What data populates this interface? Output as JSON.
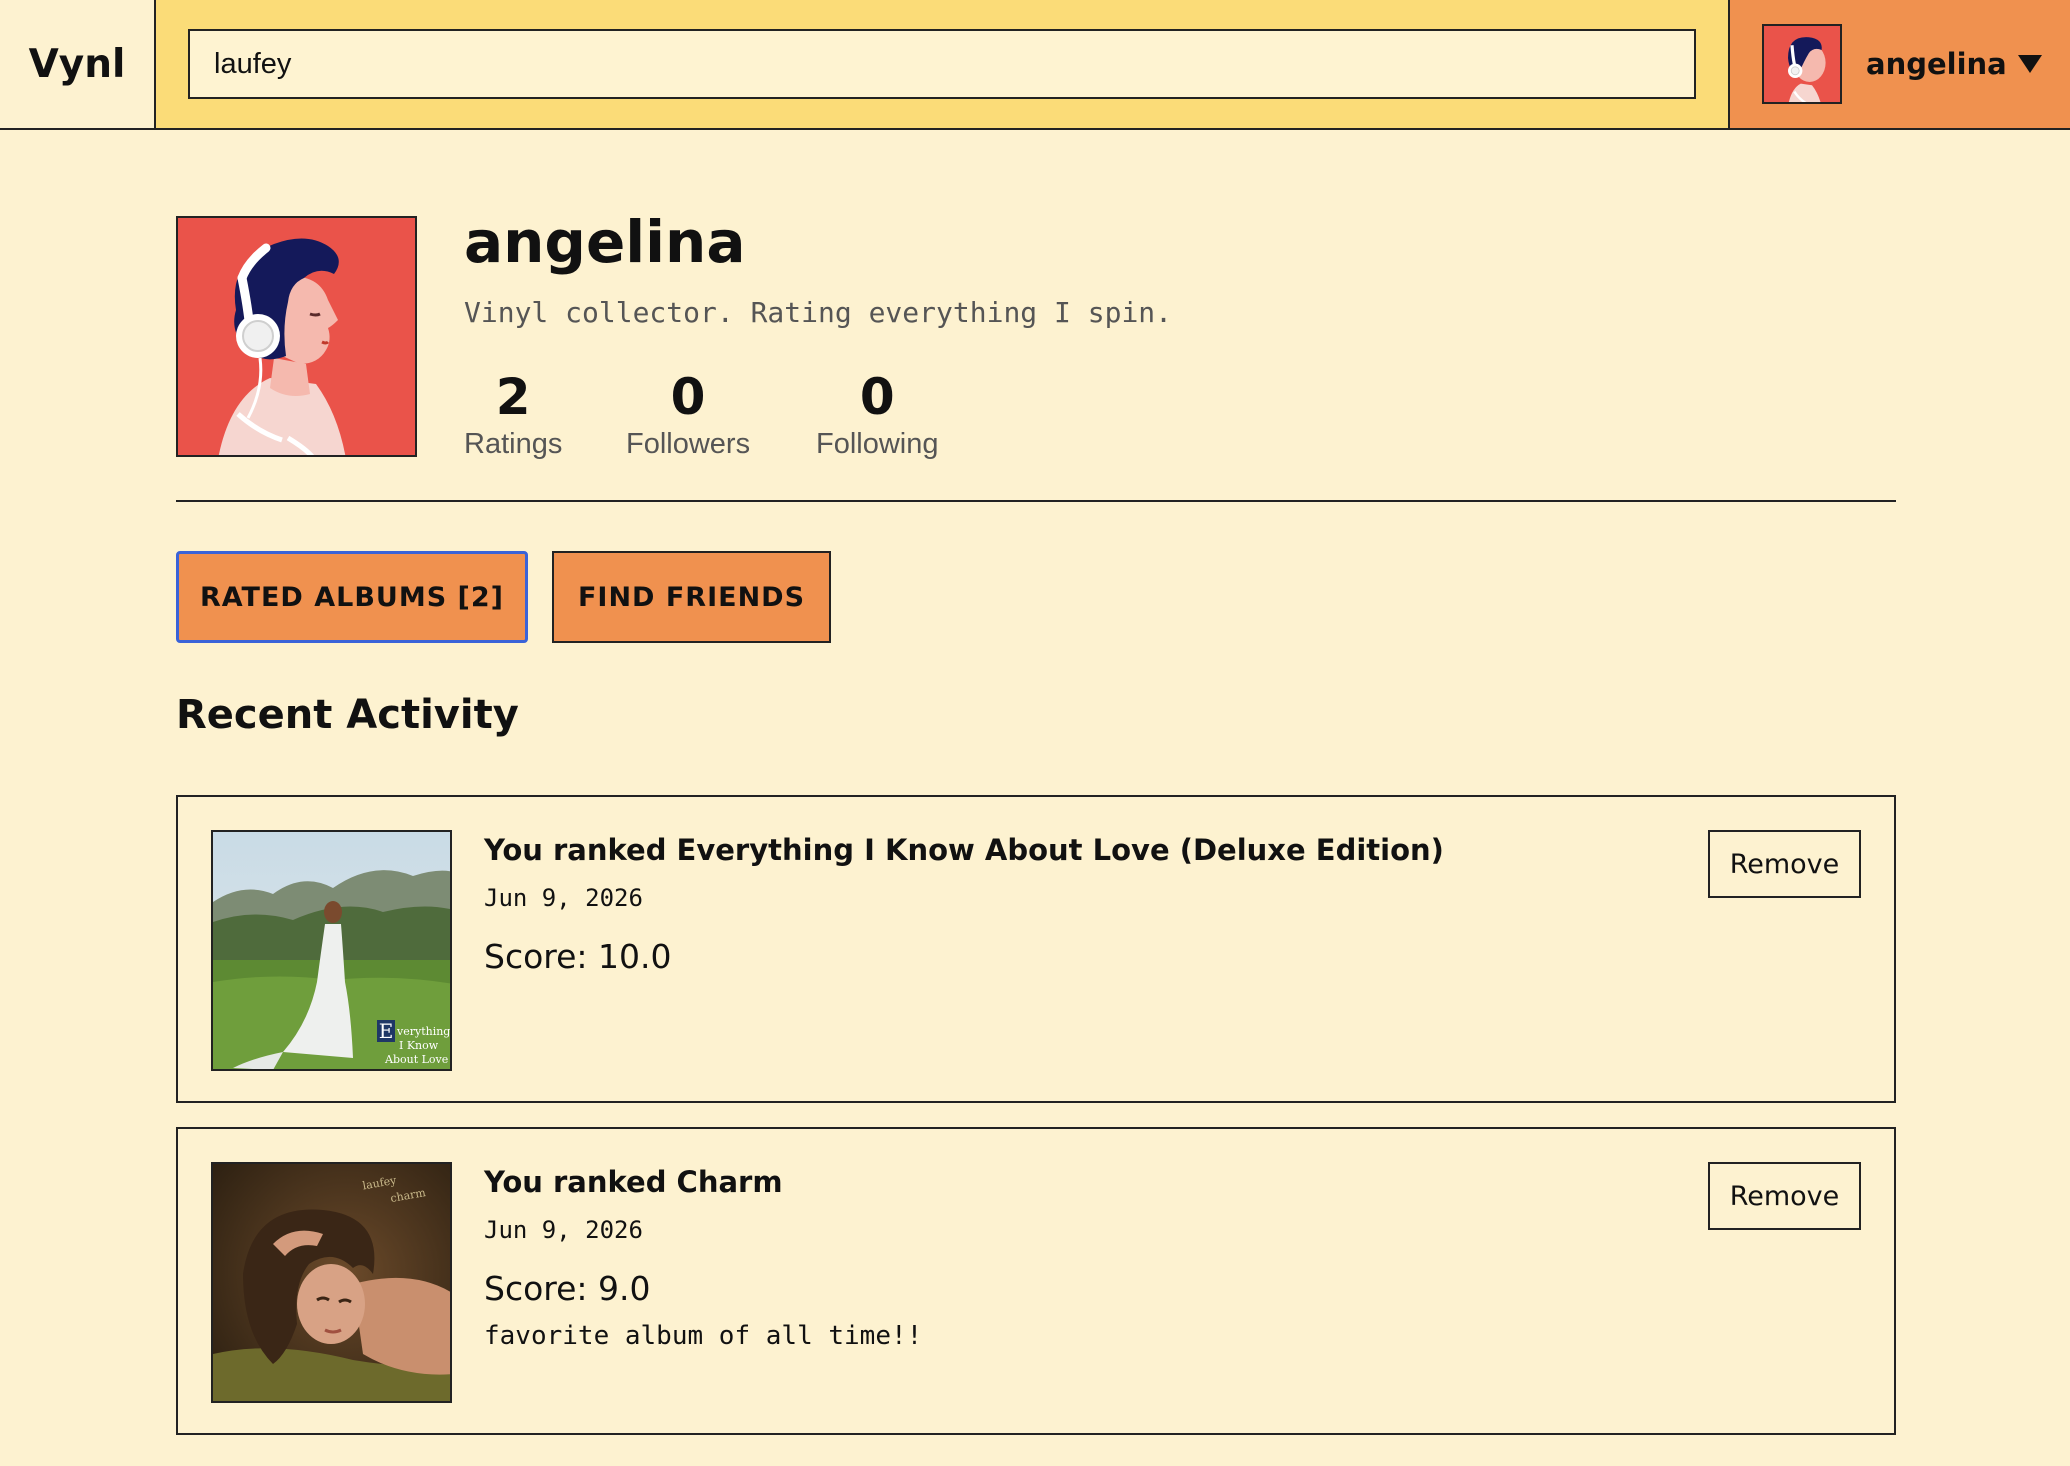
{
  "header": {
    "brand": "Vynl",
    "search_value": "laufey",
    "user_name": "angelina",
    "menu_icon": "caret-down-icon"
  },
  "profile": {
    "name": "angelina",
    "bio": "Vinyl collector. Rating everything I spin.",
    "stats": [
      {
        "value": "2",
        "label": "Ratings"
      },
      {
        "value": "0",
        "label": "Followers"
      },
      {
        "value": "0",
        "label": "Following"
      }
    ]
  },
  "buttons": {
    "rated_albums": "RATED ALBUMS [2]",
    "find_friends": "FIND FRIENDS"
  },
  "activity": {
    "title": "Recent Activity",
    "items": [
      {
        "title": "You ranked Everything I Know About Love (Deluxe Edition)",
        "date": "Jun 9, 2026",
        "score": "Score: 10.0",
        "comment": "",
        "remove_label": "Remove"
      },
      {
        "title": "You ranked Charm",
        "date": "Jun 9, 2026",
        "score": "Score: 9.0",
        "comment": "favorite album of all time!!",
        "remove_label": "Remove"
      }
    ]
  },
  "colors": {
    "page_bg": "#fdf2d0",
    "search_bar_bg": "#fbdc78",
    "accent_orange": "#f0914f",
    "avatar_red": "#ea534a",
    "focus_blue": "#3a63d8"
  }
}
